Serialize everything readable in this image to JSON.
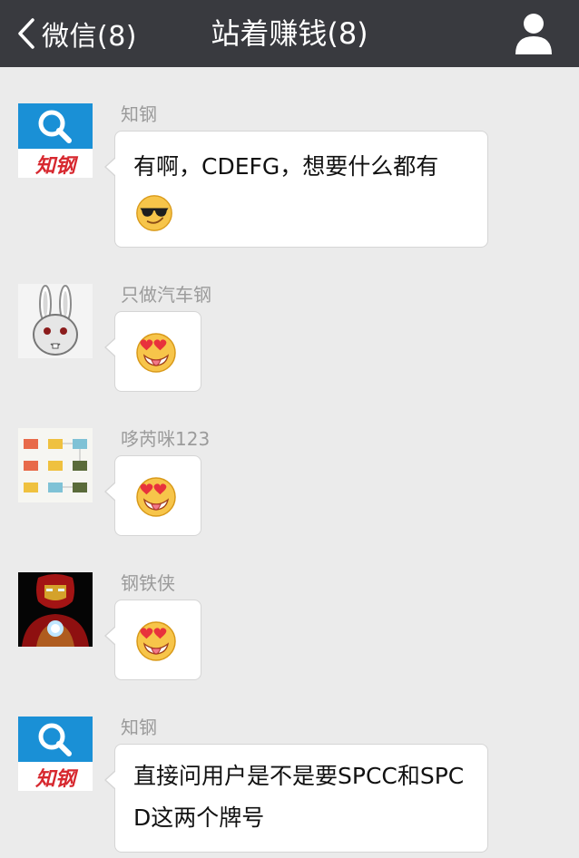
{
  "nav": {
    "back_label": "微信(8)",
    "title": "站着赚钱(8)",
    "user_icon": "person-icon"
  },
  "messages": [
    {
      "sender": "知钢",
      "avatar": "zhigang-logo",
      "text": "有啊，CDEFG，想要什么都有",
      "emoji": "cool-sunglasses-emoji"
    },
    {
      "sender": "只做汽车钢",
      "avatar": "rabbit-cartoon",
      "emoji": "heart-eyes-tongue-emoji"
    },
    {
      "sender": "哆芮咪123",
      "avatar": "color-blocks",
      "emoji": "heart-eyes-tongue-emoji"
    },
    {
      "sender": "钢铁侠",
      "avatar": "iron-man",
      "emoji": "heart-eyes-tongue-emoji"
    },
    {
      "sender": "知钢",
      "avatar": "zhigang-logo",
      "text": "直接问用户是不是要SPCC和SPCD这两个牌号"
    }
  ],
  "colors": {
    "nav_bg": "#393a3f",
    "chat_bg": "#ebebeb",
    "bubble_bg": "#ffffff",
    "sender_text": "#9b9b9b",
    "logo_blue": "#1a90d6",
    "logo_red": "#d7282f"
  }
}
